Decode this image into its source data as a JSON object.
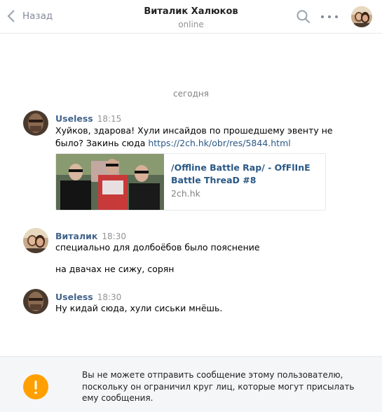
{
  "header": {
    "back_label": "Назад",
    "title": "Виталик Халюков",
    "status": "online"
  },
  "date_separator": "сегодня",
  "messages": [
    {
      "author": "Useless",
      "time": "18:15",
      "text_lines": [
        "Хуйков, здарова! Хули инсайдов по прошедшему эвенту не",
        "было? Закинь сюда "
      ],
      "link": "https://2ch.hk/obr/res/5844.html",
      "attachment": {
        "title": "/Offline Battle Rap/ - OfFlInE Battle ThreaD #8",
        "domain": "2ch.hk"
      }
    },
    {
      "author": "Виталик",
      "time": "18:30",
      "lines": [
        "специально для долбоёбов было пояснение",
        "на двачах не сижу, сорян"
      ]
    },
    {
      "author": "Useless",
      "time": "18:30",
      "lines": [
        "Ну кидай сюда, хули сиськи мнёшь."
      ]
    }
  ],
  "footer": {
    "notice": "Вы не можете отправить сообщение этому пользователю, поскольку он ограничил круг лиц, которые могут присылать ему сообщения."
  },
  "colors": {
    "link": "#2a5885",
    "author": "#42648b",
    "warning": "#ffa000"
  }
}
